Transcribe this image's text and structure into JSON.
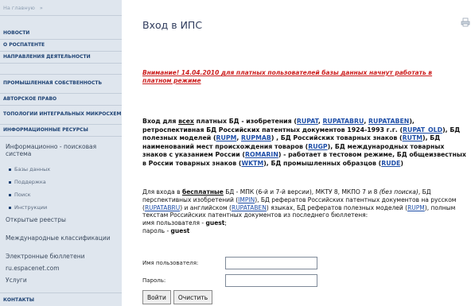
{
  "sidebar": {
    "search_label": "На главную",
    "search_btn": "»",
    "menu": [
      "НОВОСТИ",
      "О РОСПАТЕНТЕ",
      "НАПРАВЛЕНИЯ ДЕЯТЕЛЬНОСТИ"
    ],
    "menu2": [
      "ПРОМЫШЛЕННАЯ СОБСТВЕННОСТЬ",
      "АВТОРСКОЕ ПРАВО",
      "ТОПОЛОГИИ ИНТЕГРАЛЬНЫХ МИКРОСХЕМ",
      "ИНФОРМАЦИОННЫЕ РЕСУРСЫ"
    ],
    "section_title": "Информационно - поисковая система",
    "subitems": [
      "Базы данных",
      "Поддержка",
      "Поиск",
      "Инструкции"
    ],
    "links": [
      "Открытые реестры",
      "Международные классификации",
      "Электронные бюллетени",
      "ru.espacenet.com",
      "Услуги"
    ],
    "contacts": "КОНТАКТЫ"
  },
  "main": {
    "title": "Вход в ИПС",
    "notice": "Внимание! 14.04.2010 для платных пользователей базы данных начнут работать в платном режиме",
    "paid": {
      "p1": "Вход для ",
      "all": "всех",
      "p2": " платных БД - изобретения (",
      "rupat": "RUPAT",
      "c1": ", ",
      "rupatabru": "RUPATABRU",
      "c2": ", ",
      "rupatabeng": "RUPATABEN",
      "p3": "), ретроспективная БД Российских патентных документов 1924-1993 г.г. (",
      "rupat_old": "RUPAT_OLD",
      "p4": "), БД полезных моделей (",
      "rupm": "RUPM",
      "c3": ", ",
      "rupmab": "RUPMAB",
      "p5": ") , БД Российских товарных знаков (",
      "rutm": "RUTM",
      "p6": "), БД наименований мест происхождения товаров (",
      "rugp": "RUGP",
      "p7": "), БД международных товарных знаков с указанием России (",
      "romarin": "ROMARIN",
      "p8": ") - работает в тестовом режиме, БД общеизвестных в России товарных знаков (",
      "wktm": "WKTM",
      "p9": "), БД промышленных образцов (",
      "rude": "RUDE",
      "p10": ")"
    },
    "free": {
      "p1": "Для входа в ",
      "free_word": "бесплатные",
      "p2": " БД - МПК (6-й и 7-й версии), МКТУ 8, МКПО 7 и 8 ",
      "italic": "(без поиска)",
      "p3": ", БД перспективных изобретений (",
      "impin": "IMPIN",
      "p4": "), БД рефератов Российских патентных документов на русском (",
      "rupatabru": "RUPATABRU",
      "p5": ") и английском (",
      "rupatabeng": "RUPATABEN",
      "p6": ") языках, БД рефератов полезных моделей (",
      "rupm": "RUPM",
      "p7": "), полным текстам Российских патентных документов из последнего бюллетеня:",
      "user_label": "имя пользователя - ",
      "user": "guest",
      "user_end": ";",
      "pass_label": "пароль  - ",
      "pass": "guest"
    },
    "login": {
      "username_label": "Имя пользователя:",
      "username_value": "",
      "password_label": "Пароль:",
      "password_value": "",
      "submit": "Войти",
      "clear": "Очистить"
    }
  }
}
